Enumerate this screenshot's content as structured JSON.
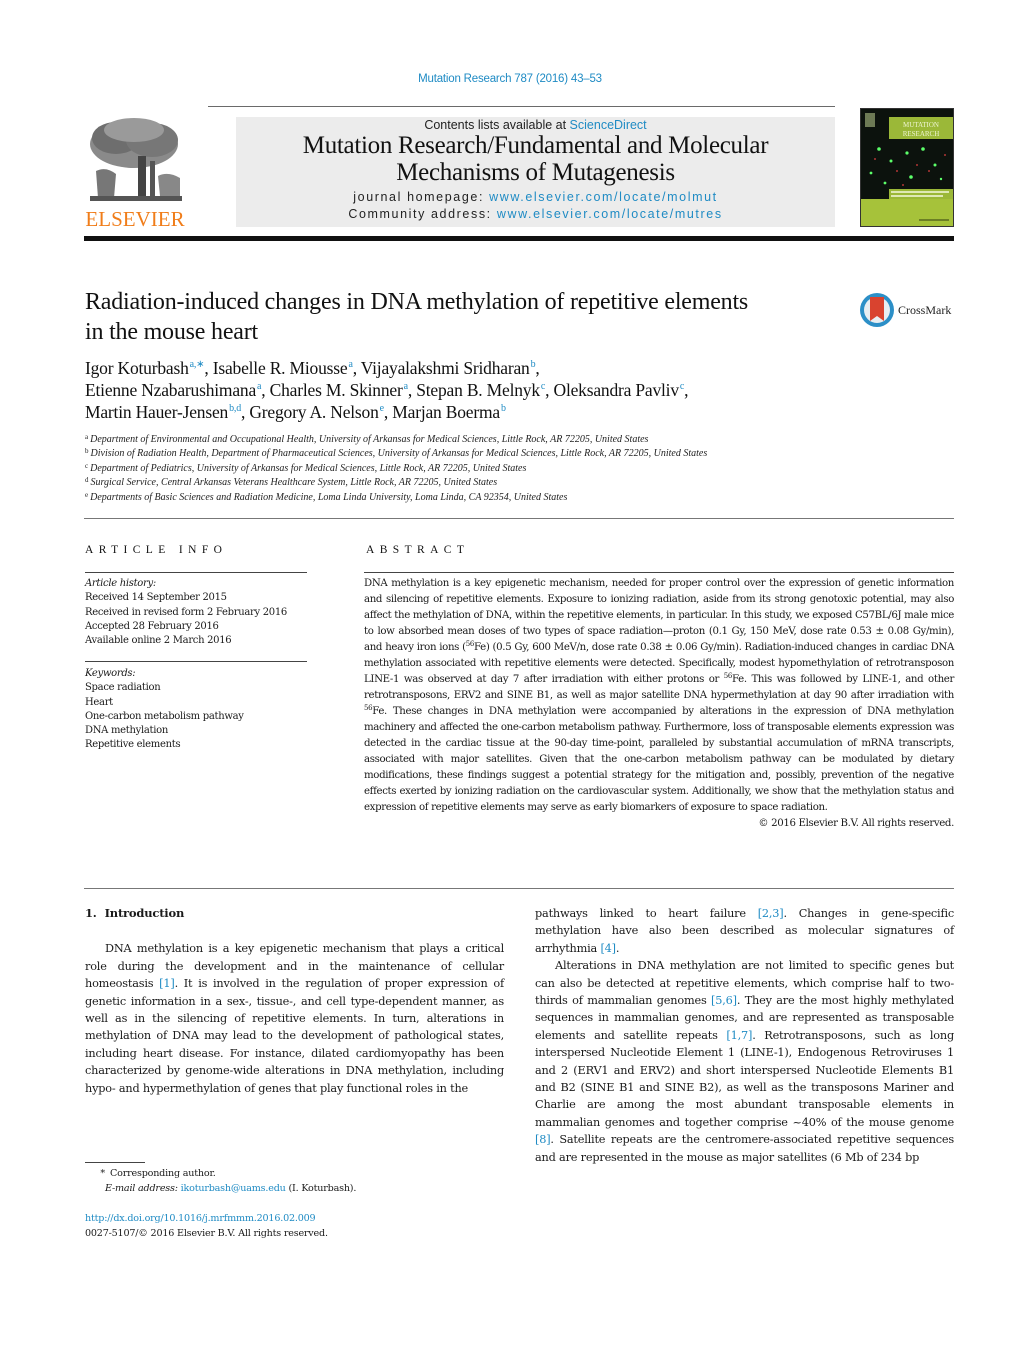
{
  "header": {
    "citation": "Mutation Research 787 (2016) 43–53",
    "publisher_logo": "ELSEVIER",
    "contents_prefix": "Contents lists available at ",
    "contents_link": "ScienceDirect",
    "journal_title_line1": "Mutation Research/Fundamental and Molecular",
    "journal_title_line2": "Mechanisms of Mutagenesis",
    "homepage_label": "journal homepage: ",
    "homepage_url": "www.elsevier.com/locate/molmut",
    "community_label": "Community address: ",
    "community_url": "www.elsevier.com/locate/mutres",
    "cover_title_line1": "MUTATION",
    "cover_title_line2": "RESEARCH",
    "colors": {
      "link": "#1f8bc4",
      "elsevier_orange": "#f07d1a",
      "cover_green": "#a6c23a"
    }
  },
  "article": {
    "title_line1": "Radiation-induced changes in DNA methylation of repetitive elements",
    "title_line2": "in the mouse heart",
    "crossmark_label": "CrossMark",
    "authors": [
      [
        {
          "name": "Igor Koturbash",
          "sup": "a,∗",
          "sep": ", "
        },
        {
          "name": "Isabelle R. Miousse",
          "sup": "a",
          "sep": ", "
        },
        {
          "name": "Vijayalakshmi Sridharan",
          "sup": "b",
          "sep": ","
        }
      ],
      [
        {
          "name": "Etienne Nzabarushimana",
          "sup": "a",
          "sep": ", "
        },
        {
          "name": "Charles M. Skinner",
          "sup": "a",
          "sep": ", "
        },
        {
          "name": "Stepan B. Melnyk",
          "sup": "c",
          "sep": ", "
        },
        {
          "name": "Oleksandra Pavliv",
          "sup": "c",
          "sep": ","
        }
      ],
      [
        {
          "name": "Martin Hauer-Jensen",
          "sup": "b,d",
          "sep": ", "
        },
        {
          "name": "Gregory A. Nelson",
          "sup": "e",
          "sep": ", "
        },
        {
          "name": "Marjan Boerma",
          "sup": "b",
          "sep": ""
        }
      ]
    ],
    "affiliations": [
      {
        "key": "a",
        "text": "Department of Environmental and Occupational Health, University of Arkansas for Medical Sciences, Little Rock, AR 72205, United States"
      },
      {
        "key": "b",
        "text": "Division of Radiation Health, Department of Pharmaceutical Sciences, University of Arkansas for Medical Sciences, Little Rock, AR 72205, United States"
      },
      {
        "key": "c",
        "text": "Department of Pediatrics, University of Arkansas for Medical Sciences, Little Rock, AR 72205, United States"
      },
      {
        "key": "d",
        "text": "Surgical Service, Central Arkansas Veterans Healthcare System, Little Rock, AR 72205, United States"
      },
      {
        "key": "e",
        "text": "Departments of Basic Sciences and Radiation Medicine, Loma Linda University, Loma Linda, CA 92354, United States"
      }
    ]
  },
  "article_info": {
    "heading": "ARTICLE INFO",
    "history_label": "Article history:",
    "history": [
      "Received 14 September 2015",
      "Received in revised form 2 February 2016",
      "Accepted 28 February 2016",
      "Available online 2 March 2016"
    ],
    "keywords_label": "Keywords:",
    "keywords": [
      "Space radiation",
      "Heart",
      "One-carbon metabolism pathway",
      "DNA methylation",
      "Repetitive elements"
    ]
  },
  "abstract": {
    "heading": "ABSTRACT",
    "part1": "DNA methylation is a key epigenetic mechanism, needed for proper control over the expression of genetic information and silencing of repetitive elements. Exposure to ionizing radiation, aside from its strong genotoxic potential, may also affect the methylation of DNA, within the repetitive elements, in particular. In this study, we exposed C57BL/6J male mice to low absorbed mean doses of two types of space radiation—proton (0.1 Gy, 150 MeV, dose rate 0.53 ± 0.08 Gy/min), and heavy iron ions (",
    "sup1": "56",
    "part2": "Fe) (0.5 Gy, 600 MeV/n, dose rate 0.38 ± 0.06 Gy/min). Radiation-induced changes in cardiac DNA methylation associated with repetitive elements were detected. Specifically, modest hypomethylation of retrotransposon LINE-1 was observed at day 7 after irradiation with either protons or ",
    "sup2": "56",
    "part3": "Fe. This was followed by LINE-1, and other retrotransposons, ERV2 and SINE B1, as well as major satellite DNA hypermethylation at day 90 after irradiation with ",
    "sup3": "56",
    "part4": "Fe. These changes in DNA methylation were accompanied by alterations in the expression of DNA methylation machinery and affected the one-carbon metabolism pathway. Furthermore, loss of transposable elements expression was detected in the cardiac tissue at the 90-day time-point, paralleled by substantial accumulation of mRNA transcripts, associated with major satellites. Given that the one-carbon metabolism pathway can be modulated by dietary modifications, these findings suggest a potential strategy for the mitigation and, possibly, prevention of the negative effects exerted by ionizing radiation on the cardiovascular system. Additionally, we show that the methylation status and expression of repetitive elements may serve as early biomarkers of exposure to space radiation.",
    "copyright": "© 2016 Elsevier B.V. All rights reserved."
  },
  "introduction": {
    "number": "1.",
    "heading": "Introduction",
    "left_p1_a": "DNA methylation is a key epigenetic mechanism that plays a critical role during the development and in the maintenance of cellular homeostasis ",
    "left_p1_ref1": "[1]",
    "left_p1_b": ". It is involved in the regulation of proper expression of genetic information in a sex-, tissue-, and cell type-dependent manner, as well as in the silencing of repetitive elements. In turn, alterations in methylation of DNA may lead to the development of pathological states, including heart disease. For instance, dilated cardiomyopathy has been characterized by genome-wide alterations in DNA methylation, including hypo- and hypermethylation of genes that play functional roles in the",
    "right_p1_a": "pathways linked to heart failure ",
    "right_p1_ref1": "[2,3]",
    "right_p1_b": ". Changes in gene-specific methylation have also been described as molecular signatures of arrhythmia ",
    "right_p1_ref2": "[4]",
    "right_p1_c": ".",
    "right_p2_a": "Alterations in DNA methylation are not limited to specific genes but can also be detected at repetitive elements, which comprise half to two-thirds of mammalian genomes ",
    "right_p2_ref1": "[5,6]",
    "right_p2_b": ". They are the most highly methylated sequences in mammalian genomes, and are represented as transposable elements and satellite repeats ",
    "right_p2_ref2": "[1,7]",
    "right_p2_c": ". Retrotransposons, such as long interspersed Nucleotide Element 1 (LINE-1), Endogenous Retroviruses 1 and 2 (ERV1 and ERV2) and short interspersed Nucleotide Elements B1 and B2 (SINE B1 and SINE B2), as well as the transposons Mariner and Charlie are among the most abundant transposable elements in mammalian genomes and together comprise ~40% of the mouse genome ",
    "right_p2_ref3": "[8]",
    "right_p2_d": ". Satellite repeats are the centromere-associated repetitive sequences and are represented in the mouse as major satellites (6 Mb of 234 bp"
  },
  "footnote": {
    "star": "*",
    "corresponding": "Corresponding author.",
    "email_label": "E-mail address:",
    "email": "ikoturbash@uams.edu",
    "email_owner": " (I. Koturbash).",
    "doi": "http://dx.doi.org/10.1016/j.mrfmmm.2016.02.009",
    "issn_copyright": "0027-5107/© 2016 Elsevier B.V. All rights reserved."
  }
}
